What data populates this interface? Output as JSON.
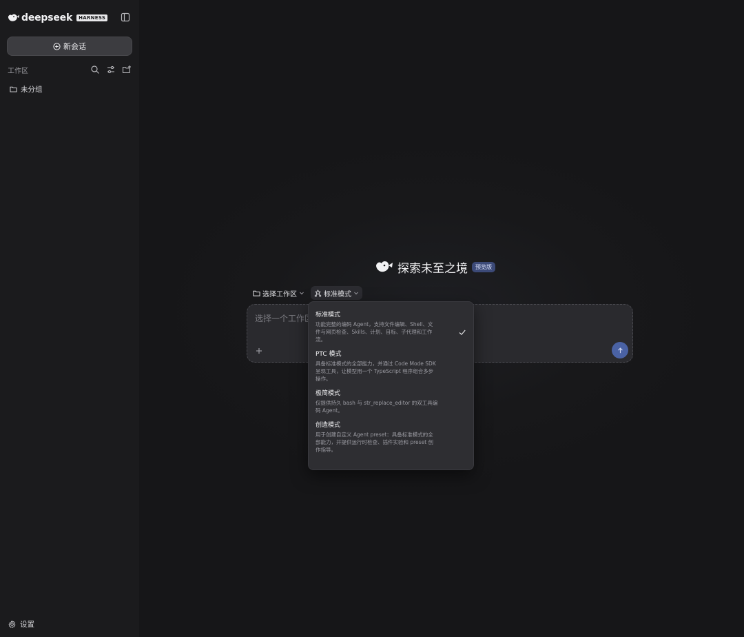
{
  "sidebar": {
    "brand": {
      "name": "deepseek",
      "tag": "HARNESS"
    },
    "new_chat_label": "新会话",
    "workspace_label": "工作区",
    "groups": [
      {
        "label": "未分组"
      }
    ],
    "settings_label": "设置"
  },
  "hero": {
    "title": "探索未至之境",
    "badge": "预览版"
  },
  "toolbar": {
    "workspace_select": "选择工作区",
    "mode_select": "标准模式"
  },
  "composer": {
    "placeholder": "选择一个工作区"
  },
  "mode_menu": {
    "selected_index": 0,
    "items": [
      {
        "title": "标准模式",
        "desc_lines": [
          "功能完整的编码 Agent，支持文件编辑、Shell、文",
          "件与网页检查、Skills、计划、目标、子代理和工作",
          "流。"
        ]
      },
      {
        "title": "PTC 模式",
        "desc_lines": [
          "具备标准模式的全部能力，并通过 Code Mode SDK",
          "呈现工具，让模型用一个 TypeScript 程序组合多步",
          "操作。"
        ]
      },
      {
        "title": "极简模式",
        "desc_lines": [
          "仅提供持久 bash 与 str_replace_editor 的双工具编",
          "码 Agent。"
        ]
      },
      {
        "title": "创造模式",
        "desc_lines": [
          "用于创建自定义 Agent preset：具备标准模式的全",
          "部能力，并提供运行时检查、插件实验和 preset 创",
          "作指导。"
        ]
      }
    ]
  },
  "colors": {
    "background": "#161618",
    "sidebar": "#1b1b1d",
    "accent_send": "#4a62a4",
    "badge": "#3c4a78"
  }
}
